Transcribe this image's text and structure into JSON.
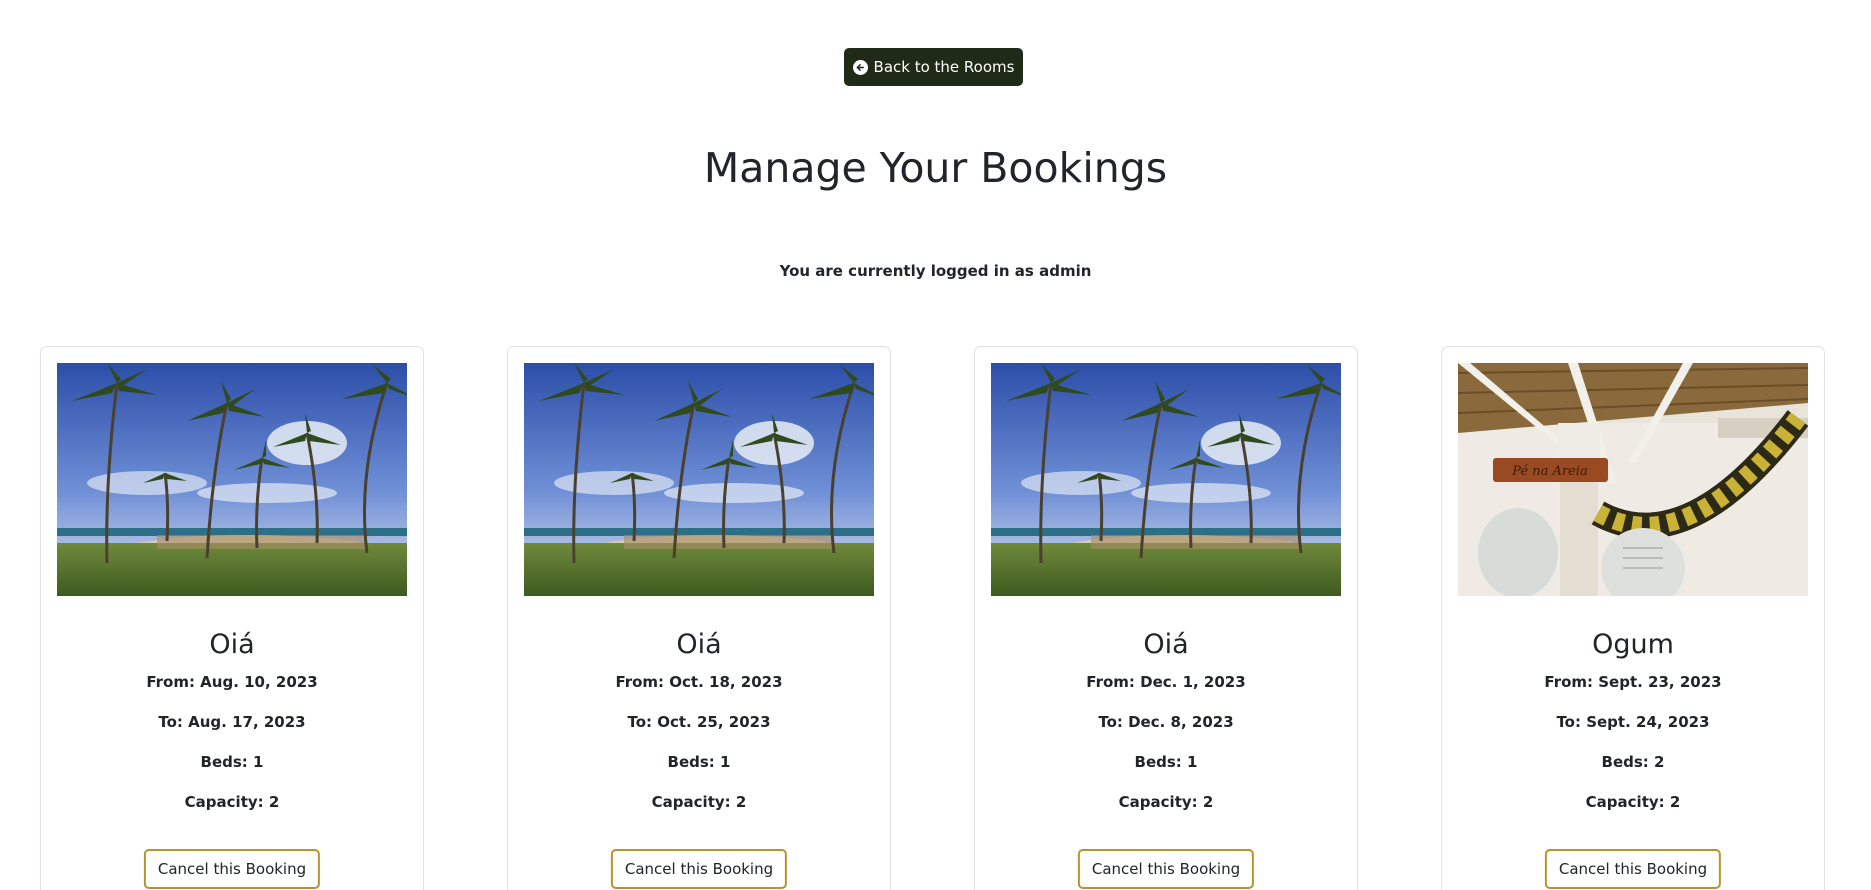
{
  "nav": {
    "back_label": "Back to the Rooms",
    "back_icon": "arrow-left-circle-icon"
  },
  "page": {
    "title": "Manage Your Bookings",
    "login_info": "You are currently logged in as admin"
  },
  "colors": {
    "back_button_bg": "#1f2b16",
    "cancel_border": "#b8922e"
  },
  "bookings": [
    {
      "room": "Oiá",
      "image": "beach-palms-photo",
      "from": "From: Aug. 10, 2023",
      "to": "To: Aug. 17, 2023",
      "beds": "Beds: 1",
      "capacity": "Capacity: 2",
      "cancel_label": "Cancel this Booking"
    },
    {
      "room": "Oiá",
      "image": "beach-palms-photo",
      "from": "From: Oct. 18, 2023",
      "to": "To: Oct. 25, 2023",
      "beds": "Beds: 1",
      "capacity": "Capacity: 2",
      "cancel_label": "Cancel this Booking"
    },
    {
      "room": "Oiá",
      "image": "beach-palms-photo",
      "from": "From: Dec. 1, 2023",
      "to": "To: Dec. 8, 2023",
      "beds": "Beds: 1",
      "capacity": "Capacity: 2",
      "cancel_label": "Cancel this Booking"
    },
    {
      "room": "Ogum",
      "image": "hammock-beach-hut-photo",
      "from": "From: Sept. 23, 2023",
      "to": "To: Sept. 24, 2023",
      "beds": "Beds: 2",
      "capacity": "Capacity: 2",
      "cancel_label": "Cancel this Booking"
    }
  ]
}
